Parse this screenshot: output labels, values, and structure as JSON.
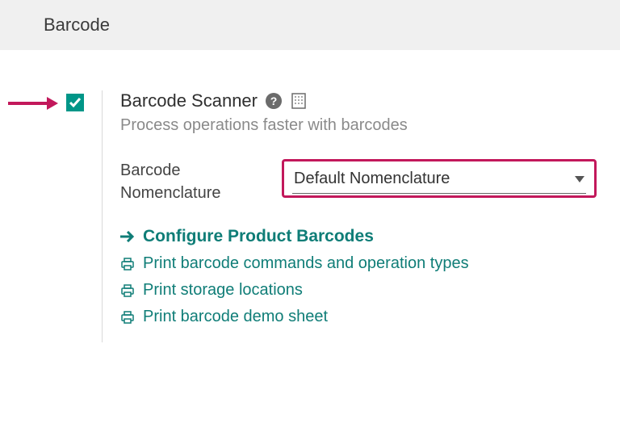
{
  "section": {
    "title": "Barcode"
  },
  "setting": {
    "checked": true,
    "title": "Barcode Scanner",
    "description": "Process operations faster with barcodes"
  },
  "field": {
    "label": "Barcode Nomenclature",
    "value": "Default Nomenclature"
  },
  "links": {
    "configure": "Configure Product Barcodes",
    "print_commands": "Print barcode commands and operation types",
    "print_locations": "Print storage locations",
    "print_demo": "Print barcode demo sheet"
  },
  "colors": {
    "teal": "#009688",
    "highlight": "#c2185b",
    "link": "#0f7d77"
  }
}
